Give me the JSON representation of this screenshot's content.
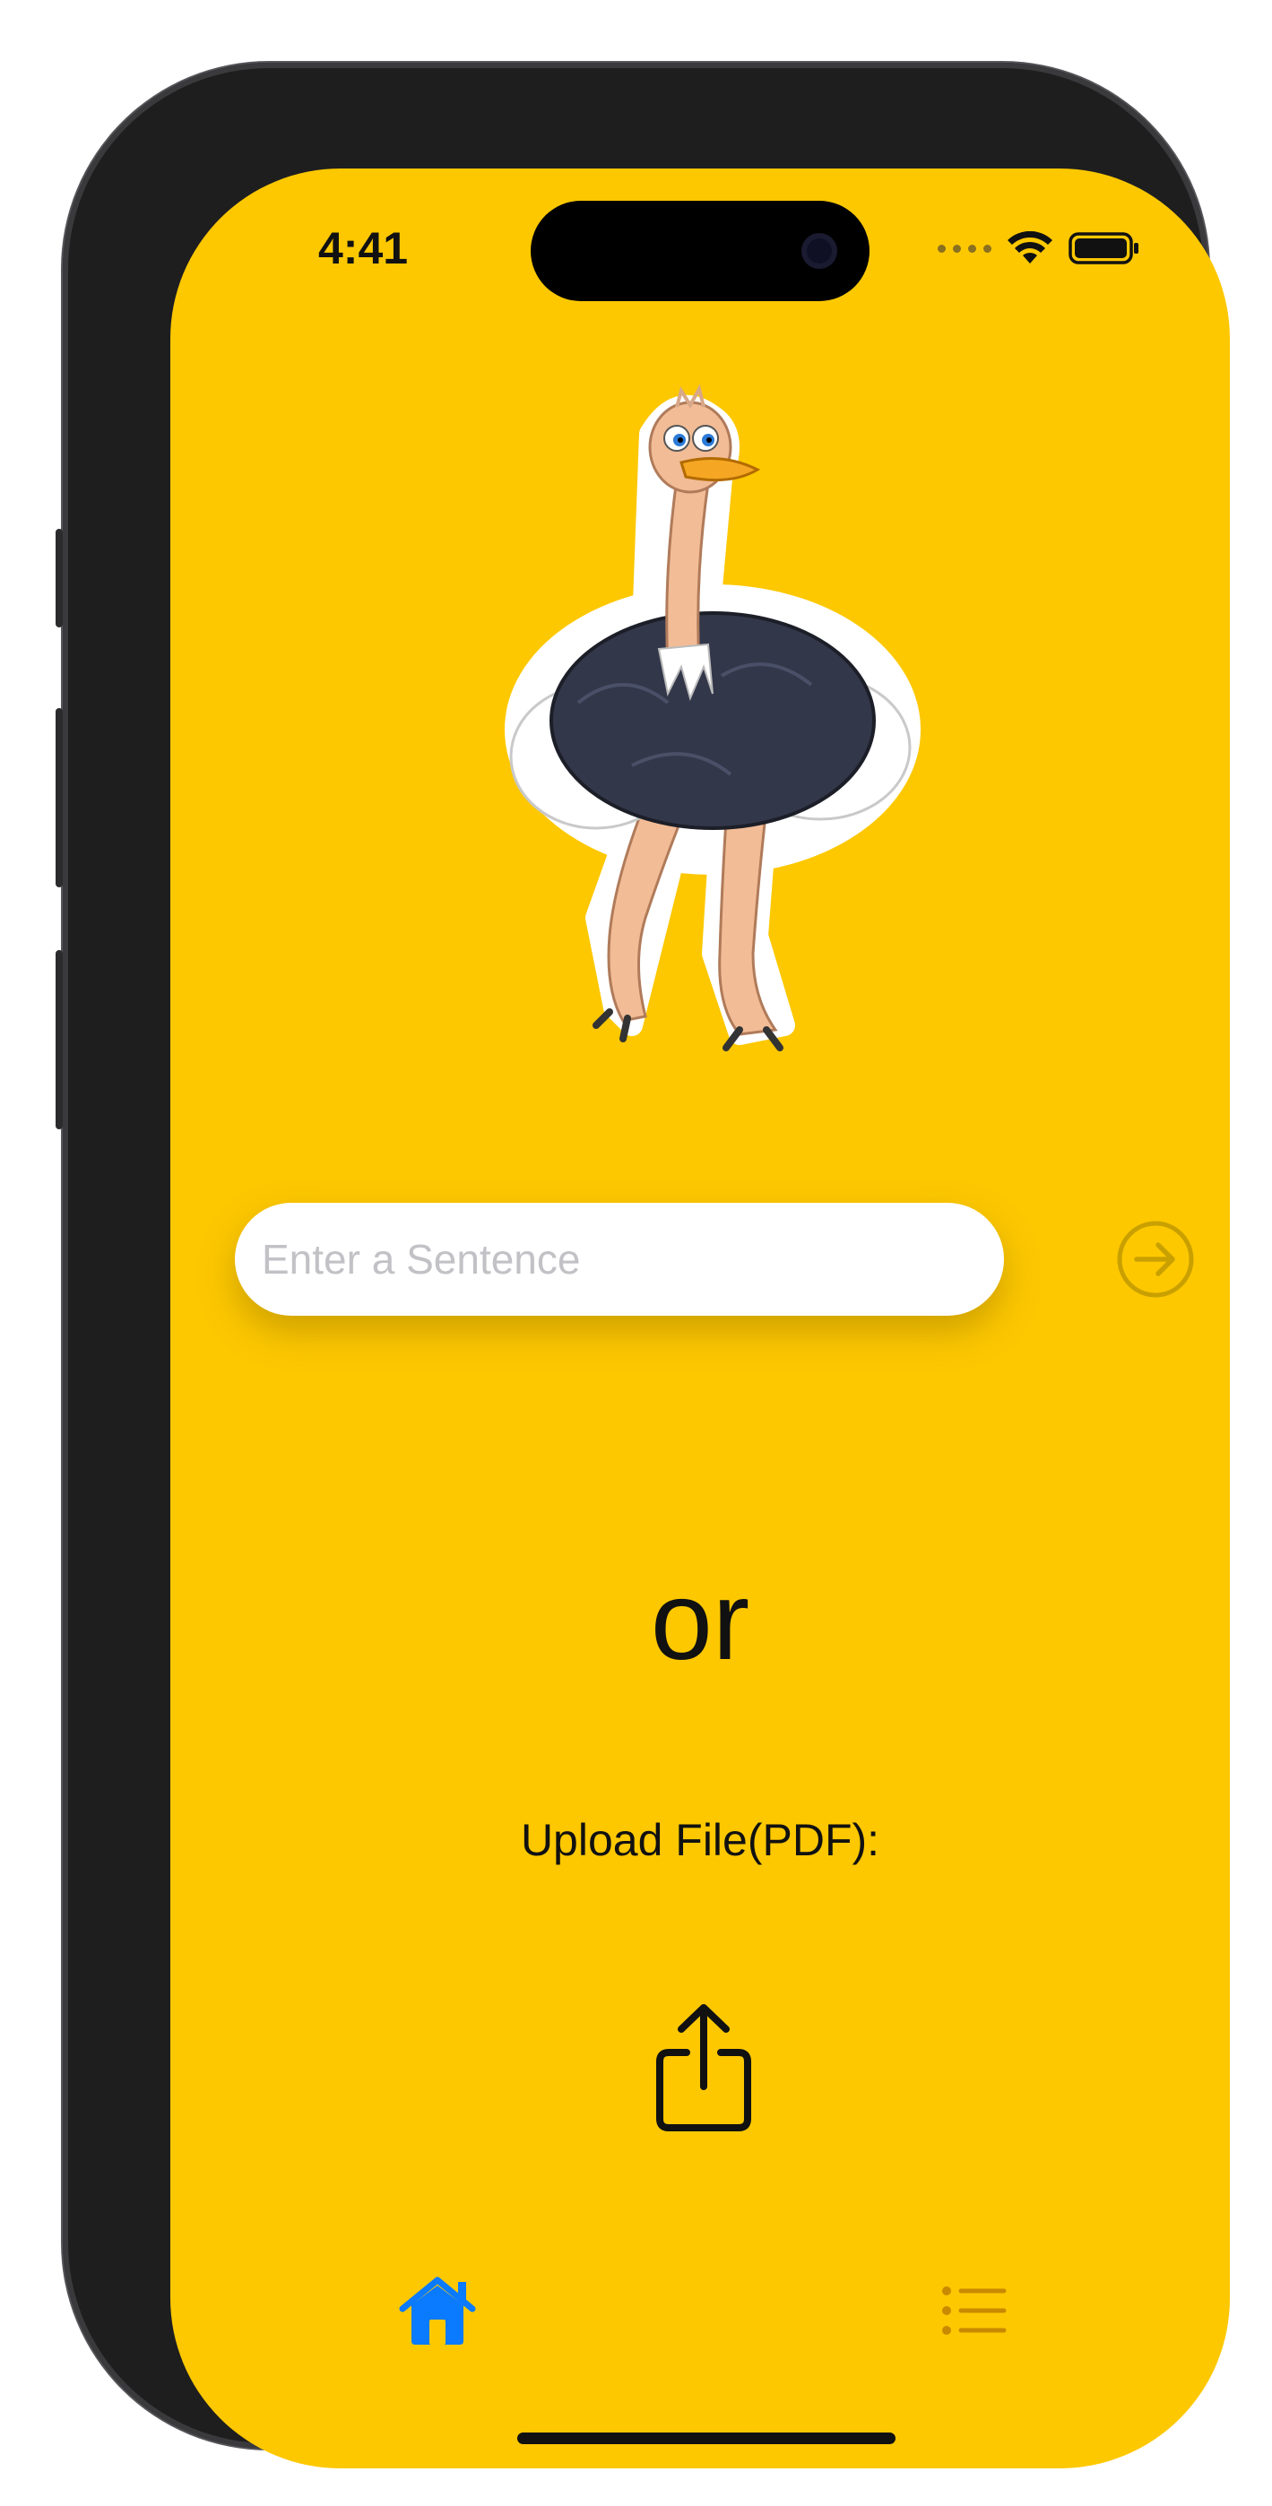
{
  "status_bar": {
    "time": "4:41",
    "icons": [
      "cellular-dots-icon",
      "wifi-icon",
      "battery-icon"
    ]
  },
  "mascot": {
    "icon": "ostrich-icon"
  },
  "input": {
    "placeholder": "Enter a Sentence",
    "value": "",
    "submit_icon": "arrow-right-circle-icon"
  },
  "separator": {
    "text": "or"
  },
  "upload": {
    "label": "Upload File(PDF):",
    "icon": "share-upload-icon"
  },
  "tab_bar": {
    "items": [
      {
        "name": "home",
        "icon": "house-icon",
        "selected": true
      },
      {
        "name": "list",
        "icon": "list-bullet-icon",
        "selected": false
      }
    ]
  },
  "colors": {
    "background": "#fdc800",
    "tab_selected": "#0a7aff",
    "tab_unselected": "#c98a00",
    "submit_disabled": "#c9a000"
  }
}
